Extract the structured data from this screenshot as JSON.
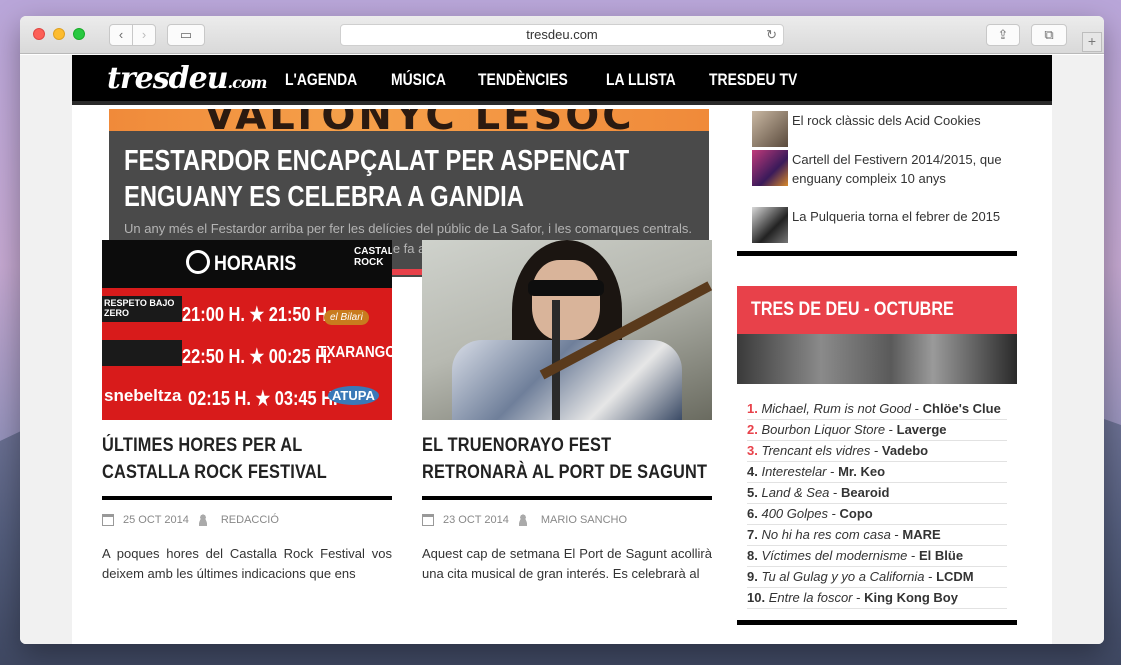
{
  "browser": {
    "url": "tresdeu.com",
    "back_label": "‹",
    "forward_label": "›",
    "sidebar_label": "▭",
    "share_label": "⇪",
    "tabs_label": "⧉",
    "newtab_label": "+",
    "reload_label": "↻"
  },
  "header": {
    "logo_main": "tresdeu",
    "logo_suffix": ".com",
    "menu": [
      {
        "label": "L'AGENDA"
      },
      {
        "label": "MÚSICA"
      },
      {
        "label": "TENDÈNCIES"
      },
      {
        "label": "LA LLISTA"
      },
      {
        "label": "TRESDEU TV"
      }
    ]
  },
  "slider": {
    "image_text": "VALTONYC   LESOC",
    "title": "FESTARDOR ENCAPÇALAT PER ASPENCAT ENGUANY ES CELEBRA A GANDIA",
    "excerpt": "Un any més el Festardor arriba per fer les delícies del públic de La Safor, i les comarques centrals. En aquesta edició hi ha varies novetats, pel que fa a la data, que torna a novembre, i el lloc,...",
    "progress": 0.67
  },
  "articles": [
    {
      "title": "ÚLTIMES HORES PER AL CASTALLA ROCK FESTIVAL",
      "date": "25 OCT 2014",
      "author": "REDACCIÓ",
      "excerpt": "A poques hores del Castalla Rock Festival vos deixem amb les últimes indicacions que ens",
      "image": {
        "heading": "HORARIS",
        "logo": "CASTALLA ROCK",
        "rows": [
          {
            "band_left": "RESPETO BAJO ZERO",
            "times": "21:00 H. ★ 21:50 H.",
            "band_right": "el Bilari"
          },
          {
            "band_left": "",
            "times": "22:50 H. ★ 00:25 H.",
            "band_right": "TXARANGO"
          },
          {
            "band_left": "snebeltza",
            "times": "02:15 H. ★ 03:45 H.",
            "band_right": "ATUPA"
          }
        ]
      }
    },
    {
      "title": "EL TRUENORAYO FEST RETRONARÀ AL PORT DE SAGUNT",
      "date": "23 OCT 2014",
      "author": "MARIO SANCHO",
      "excerpt": "Aquest cap de setmana El Port de Sagunt acollirà una cita musical de gran interés. Es celebrarà al"
    }
  ],
  "sidebar": {
    "recent": [
      {
        "text": "El rock clàssic dels Acid Cookies"
      },
      {
        "text": "Cartell del Festivern 2014/2015, que enguany compleix 10 anys"
      },
      {
        "text": "La Pulqueria torna el febrer de 2015"
      }
    ],
    "top10_title": "TRES DE DEU - OCTUBRE",
    "top10": [
      {
        "num": "1.",
        "song": "Michael, Rum is not Good",
        "sep": " - ",
        "artist": "Chlöe's Clue"
      },
      {
        "num": "2.",
        "song": "Bourbon Liquor Store",
        "sep": " - ",
        "artist": "Laverge"
      },
      {
        "num": "3.",
        "song": "Trencant els vidres",
        "sep": " - ",
        "artist": "Vadebo"
      },
      {
        "num": "4.",
        "song": "Interestelar",
        "sep": " - ",
        "artist": "Mr. Keo"
      },
      {
        "num": "5.",
        "song": "Land & Sea",
        "sep": " - ",
        "artist": "Bearoid"
      },
      {
        "num": "6.",
        "song": "400 Golpes",
        "sep": " - ",
        "artist": "Copo"
      },
      {
        "num": "7.",
        "song": "No hi ha res com casa",
        "sep": " - ",
        "artist": "MARE"
      },
      {
        "num": "8.",
        "song": "Víctimes del modernisme",
        "sep": " - ",
        "artist": "El Blüe"
      },
      {
        "num": "9.",
        "song": "Tu al Gulag y yo a California",
        "sep": " - ",
        "artist": "LCDM"
      },
      {
        "num": "10.",
        "song": "Entre la foscor",
        "sep": " - ",
        "artist": "King Kong Boy"
      }
    ]
  },
  "colors": {
    "accent": "#e8414a",
    "header_bg": "#000000",
    "slider_bg": "#4a4a4a"
  }
}
